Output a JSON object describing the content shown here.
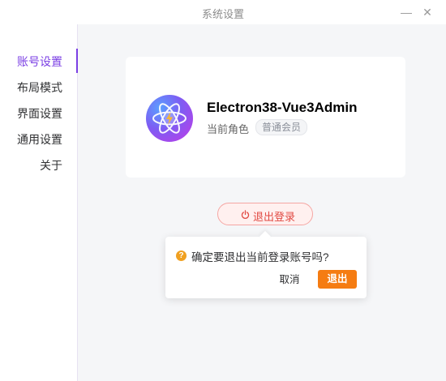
{
  "window": {
    "title": "系统设置",
    "minimize_glyph": "—",
    "close_glyph": "✕"
  },
  "sidebar": {
    "items": [
      {
        "label": "账号设置",
        "active": true
      },
      {
        "label": "布局模式",
        "active": false
      },
      {
        "label": "界面设置",
        "active": false
      },
      {
        "label": "通用设置",
        "active": false
      },
      {
        "label": "关于",
        "active": false
      }
    ],
    "accent_color": "#7b3fe4"
  },
  "account": {
    "username": "Electron38-Vue3Admin",
    "role_label": "当前角色",
    "role_tag": "普通会员",
    "avatar_icon": "atom-bolt-logo"
  },
  "logout": {
    "label": "退出登录",
    "icon": "power-icon"
  },
  "popconfirm": {
    "message": "确定要退出当前登录账号吗?",
    "cancel_label": "取消",
    "confirm_label": "退出",
    "icon": "question-warning-icon",
    "confirm_color": "#f57c12"
  }
}
